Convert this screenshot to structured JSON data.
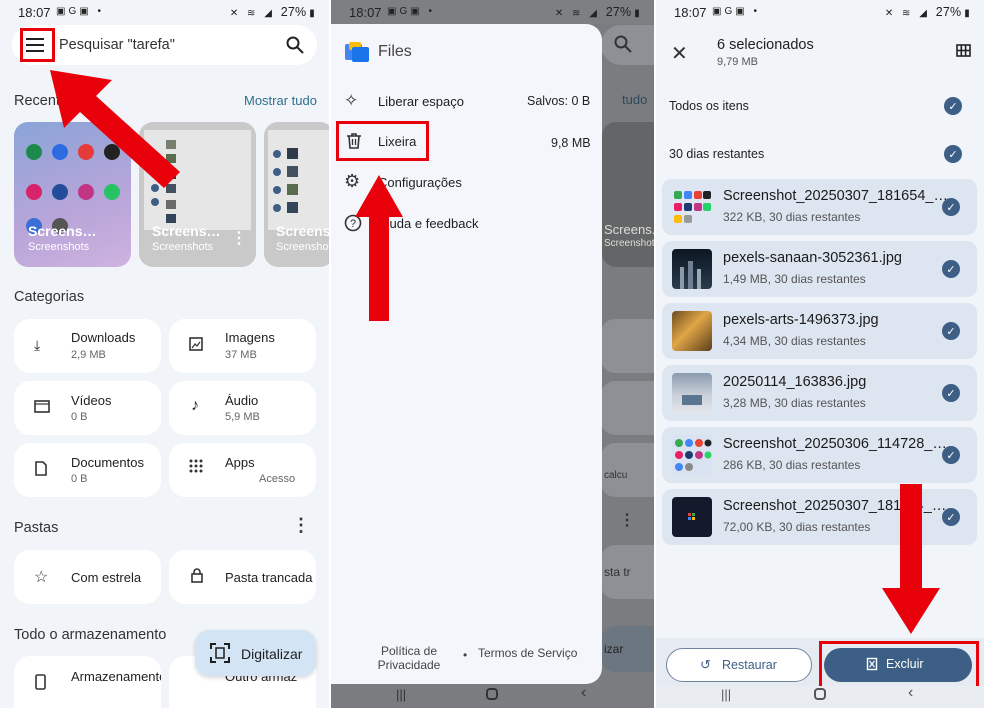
{
  "status": {
    "time": "18:07",
    "battery": "27%"
  },
  "home": {
    "search_placeholder": "Pesquisar \"tarefa\"",
    "recents_title": "Recentes",
    "show_all": "Mostrar tudo",
    "recent_items": [
      {
        "name": "Screens…",
        "label": "Screenshots"
      },
      {
        "name": "Screens…",
        "label": "Screenshots"
      },
      {
        "name": "Screens…",
        "label": "Screenshot"
      }
    ],
    "categories_title": "Categorias",
    "categories": [
      {
        "name": "Downloads",
        "size": "2,9 MB",
        "icon": "download-icon"
      },
      {
        "name": "Imagens",
        "size": "37 MB",
        "icon": "image-icon"
      },
      {
        "name": "Vídeos",
        "size": "0 B",
        "icon": "video-icon"
      },
      {
        "name": "Áudio",
        "size": "5,9 MB",
        "icon": "music-note-icon"
      },
      {
        "name": "Documentos",
        "size": "0 B",
        "icon": "document-icon"
      },
      {
        "name": "Apps",
        "size": "Acesso",
        "icon": "apps-grid-icon"
      }
    ],
    "folders_title": "Pastas",
    "folders": [
      {
        "name": "Com estrela",
        "icon": "star-icon"
      },
      {
        "name": "Pasta trancada",
        "icon": "lock-icon"
      }
    ],
    "storage_title": "Todo o armazenamento",
    "storage_items": [
      {
        "name": "Armazenamento"
      },
      {
        "name": "Outro armaz"
      }
    ],
    "scan_label": "Digitalizar"
  },
  "drawer": {
    "app_name": "Files",
    "items": [
      {
        "label": "Liberar espaço",
        "value": "Salvos: 0 B",
        "icon": "sparkle-icon"
      },
      {
        "label": "Lixeira",
        "value": "9,8 MB",
        "icon": "trash-icon"
      },
      {
        "label": "Configurações",
        "value": "",
        "icon": "gear-icon"
      },
      {
        "label": "Ajuda e feedback",
        "value": "",
        "icon": "help-icon"
      }
    ],
    "footer": {
      "privacy": "Política de Privacidade",
      "terms": "Termos de Serviço"
    },
    "behind": {
      "show_all_partial": "tudo",
      "screens_partial": "Screens...",
      "screenshot_partial": "Screenshot",
      "calc_partial": "calcu",
      "pasta_partial": "sta tr",
      "scan_partial": "izar"
    }
  },
  "trash": {
    "title": "6 selecionados",
    "subtitle": "9,79 MB",
    "all_items": "Todos os itens",
    "remaining_group": "30 dias restantes",
    "files": [
      {
        "name": "Screenshot_20250307_181654_…",
        "meta": "322 KB, 30 dias restantes"
      },
      {
        "name": "pexels-sanaan-3052361.jpg",
        "meta": "1,49 MB, 30 dias restantes"
      },
      {
        "name": "pexels-arts-1496373.jpg",
        "meta": "4,34 MB, 30 dias restantes"
      },
      {
        "name": "20250114_163836.jpg",
        "meta": "3,28 MB, 30 dias restantes"
      },
      {
        "name": "Screenshot_20250306_114728_…",
        "meta": "286 KB, 30 dias restantes"
      },
      {
        "name": "Screenshot_20250307_181…4_…",
        "meta": "72,00 KB, 30 dias restantes"
      }
    ],
    "restore_label": "Restaurar",
    "delete_label": "Excluir"
  },
  "colors": {
    "accent": "#3d5f85",
    "highlight": "#e8000b",
    "link": "#2f6f8f"
  }
}
